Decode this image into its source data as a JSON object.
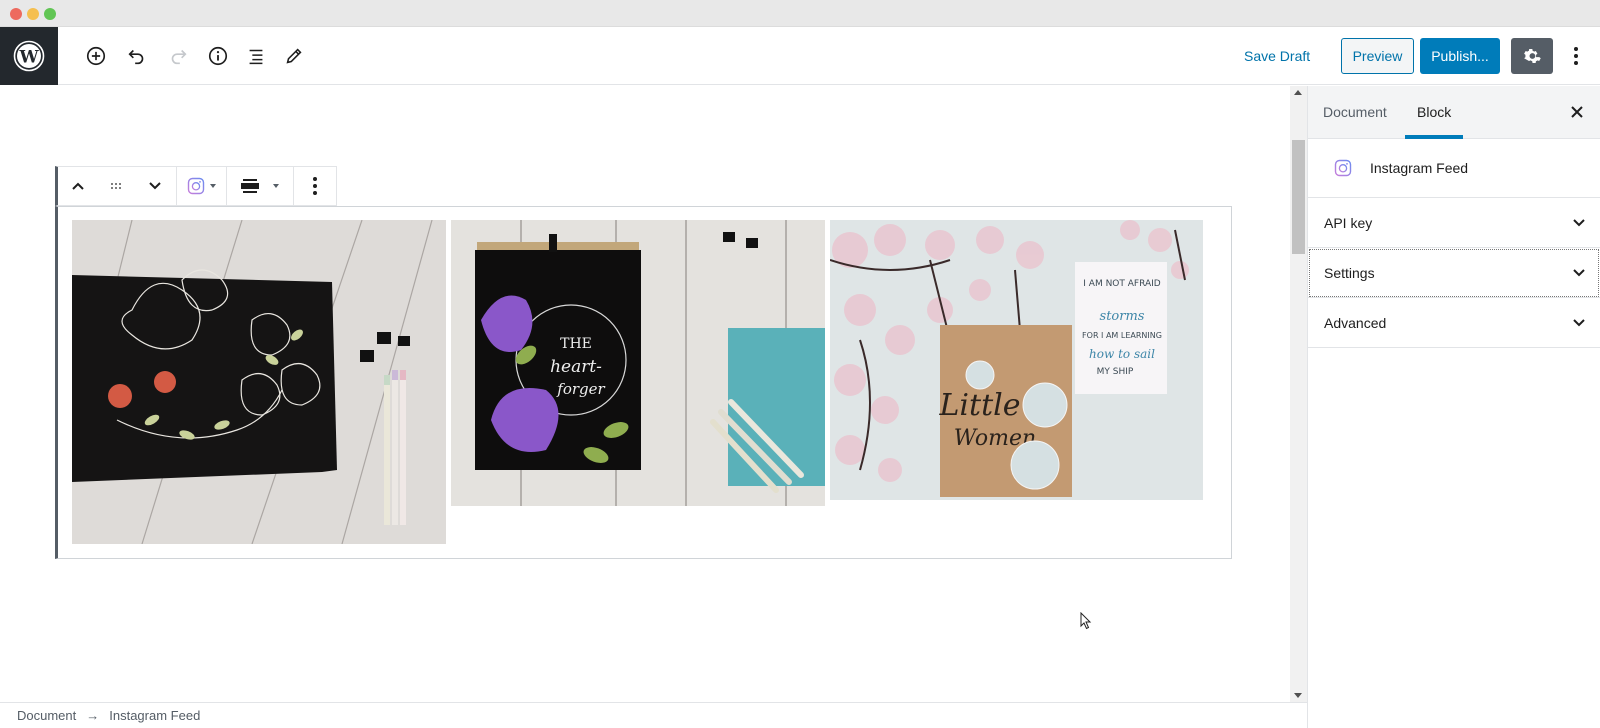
{
  "window": {
    "controls": [
      "close",
      "minimize",
      "maximize"
    ]
  },
  "header": {
    "logo_icon": "wordpress-logo-icon",
    "tools": [
      {
        "name": "add-block",
        "icon": "plus-circle-icon"
      },
      {
        "name": "undo",
        "icon": "undo-icon"
      },
      {
        "name": "redo",
        "icon": "redo-icon",
        "disabled": true
      },
      {
        "name": "content-structure",
        "icon": "info-icon"
      },
      {
        "name": "block-navigation",
        "icon": "list-icon"
      },
      {
        "name": "tools",
        "icon": "pencil-icon"
      }
    ],
    "save_draft_label": "Save Draft",
    "preview_label": "Preview",
    "publish_label": "Publish...",
    "settings_icon": "gear-icon",
    "more_icon": "vertical-ellipsis-icon"
  },
  "block_toolbar": {
    "move_up_icon": "chevron-up-icon",
    "drag_icon": "drag-handle-icon",
    "move_down_icon": "chevron-down-icon",
    "block_type_icon": "instagram-icon",
    "align_icon": "align-wide-icon",
    "more_icon": "vertical-ellipsis-icon"
  },
  "block": {
    "type": "Instagram Feed",
    "photos": [
      {
        "description": "Black sketchbook with white floral line drawing, red berries, binder clips and pastel pens on white wood"
      },
      {
        "description": "Black notebook with purple magnolias and 'THE heart-forger' lettering, teal book and pens on white wood"
      },
      {
        "description": "Cherry blossom branches with kraft 'Little Women' notebook and journal page 'I am not afraid of storms for I am learning how to sail my ship'"
      }
    ]
  },
  "breadcrumb": {
    "items": [
      "Document",
      "Instagram Feed"
    ],
    "separator": "→"
  },
  "sidebar": {
    "tabs": [
      {
        "label": "Document",
        "active": false
      },
      {
        "label": "Block",
        "active": true
      }
    ],
    "close_icon": "close-icon",
    "block_card": {
      "icon": "instagram-icon",
      "name": "Instagram Feed"
    },
    "panels": [
      {
        "label": "API key",
        "expanded": false
      },
      {
        "label": "Settings",
        "expanded": false,
        "focused": true
      },
      {
        "label": "Advanced",
        "expanded": false
      }
    ]
  },
  "colors": {
    "accent": "#007cba",
    "link": "#0073aa",
    "dark": "#23282d",
    "settings_active": "#555d66"
  }
}
